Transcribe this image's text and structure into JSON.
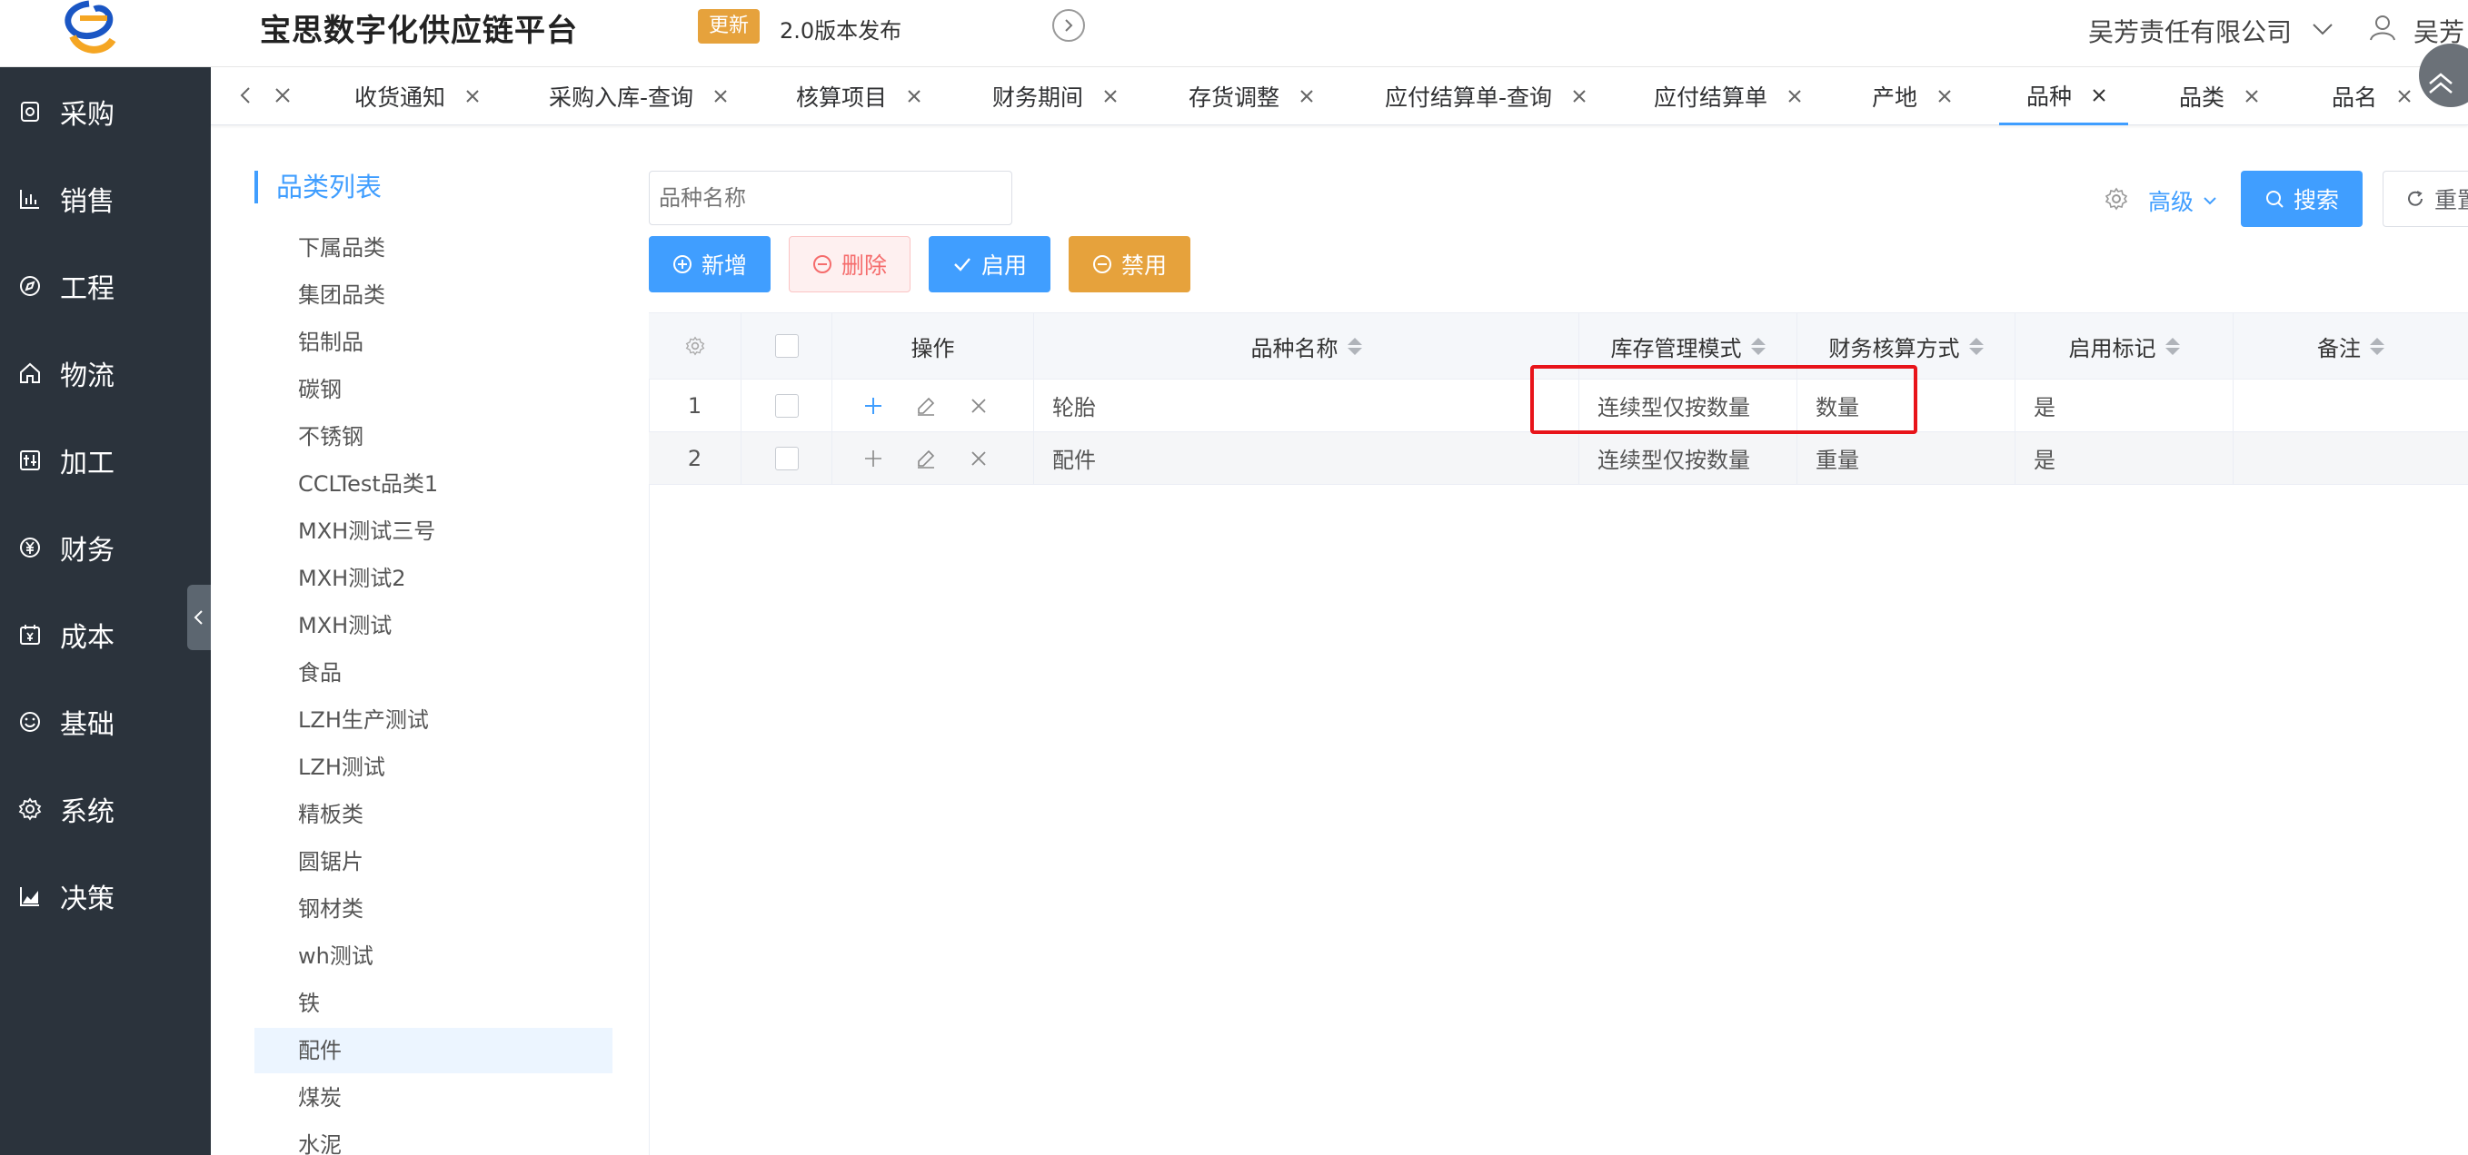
{
  "header": {
    "app_title": "宝思数字化供应链平台",
    "update_badge": "更新",
    "release_note": "2.0版本发布",
    "company": "吴芳责任有限公司",
    "user_name": "吴芳"
  },
  "sidebar": {
    "items": [
      {
        "label": "采购",
        "icon": "purchase-icon"
      },
      {
        "label": "销售",
        "icon": "sales-chart-icon"
      },
      {
        "label": "工程",
        "icon": "compass-icon"
      },
      {
        "label": "物流",
        "icon": "home-icon"
      },
      {
        "label": "加工",
        "icon": "process-icon"
      },
      {
        "label": "财务",
        "icon": "yen-icon"
      },
      {
        "label": "成本",
        "icon": "calendar-yen-icon"
      },
      {
        "label": "基础",
        "icon": "smile-icon"
      },
      {
        "label": "系统",
        "icon": "gear-icon"
      },
      {
        "label": "决策",
        "icon": "area-chart-icon"
      }
    ]
  },
  "tabs": [
    {
      "label": "收货通知"
    },
    {
      "label": "采购入库-查询"
    },
    {
      "label": "核算项目"
    },
    {
      "label": "财务期间"
    },
    {
      "label": "存货调整"
    },
    {
      "label": "应付结算单-查询"
    },
    {
      "label": "应付结算单"
    },
    {
      "label": "产地"
    },
    {
      "label": "品种",
      "active": true
    },
    {
      "label": "品类"
    },
    {
      "label": "品名"
    }
  ],
  "category_panel": {
    "title": "品类列表",
    "items": [
      "下属品类",
      "集团品类",
      "铝制品",
      "碳钢",
      "不锈钢",
      "CCLTest品类1",
      "MXH测试三号",
      "MXH测试2",
      "MXH测试",
      "食品",
      "LZH生产测试",
      "LZH测试",
      "精板类",
      "圆锯片",
      "钢材类",
      "wh测试",
      "铁",
      "配件",
      "煤炭",
      "水泥"
    ],
    "selected": "配件"
  },
  "toolbar": {
    "search_placeholder": "品种名称",
    "add": "新增",
    "delete": "删除",
    "enable": "启用",
    "disable": "禁用",
    "advanced": "高级",
    "search": "搜索",
    "reset": "重置"
  },
  "table": {
    "columns": {
      "operation": "操作",
      "variety_name": "品种名称",
      "inventory_mode": "库存管理模式",
      "accounting_method": "财务核算方式",
      "enabled_flag": "启用标记",
      "remark": "备注"
    },
    "rows": [
      {
        "index": "1",
        "variety_name": "轮胎",
        "inventory_mode": "连续型仅按数量",
        "accounting_method": "数量",
        "enabled_flag": "是",
        "remark": ""
      },
      {
        "index": "2",
        "variety_name": "配件",
        "inventory_mode": "连续型仅按数量",
        "accounting_method": "重量",
        "enabled_flag": "是",
        "remark": ""
      }
    ]
  },
  "colors": {
    "primary": "#409eff",
    "warning": "#e6a23c",
    "danger": "#f56c6c",
    "sidebar_bg": "#2b333c",
    "highlight": "#e8141a"
  }
}
